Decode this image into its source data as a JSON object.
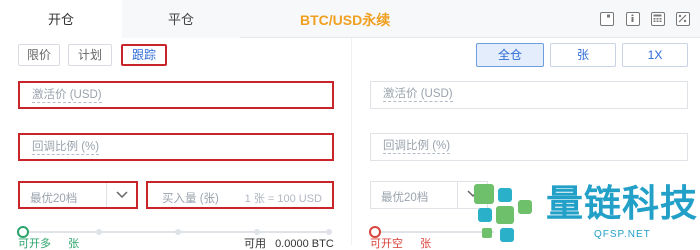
{
  "tabs": {
    "open": "开仓",
    "close": "平仓"
  },
  "market_title": "BTC/USD永续",
  "order_types": [
    {
      "label": "限价"
    },
    {
      "label": "计划"
    },
    {
      "label": "跟踪"
    }
  ],
  "amount_modes": [
    {
      "label": "全仓"
    },
    {
      "label": "张"
    },
    {
      "label": "1X"
    }
  ],
  "left_form": {
    "activation_placeholder": "激活价 (USD)",
    "callback_placeholder": "回调比例 (%)",
    "price_select": "最优20档",
    "buy_qty_placeholder": "买入量 (张)",
    "contract_hint": "1 张 = 100 USD",
    "open_label": "可开多",
    "open_value": "张",
    "available_label": "可用",
    "available_value": "0.0000 BTC"
  },
  "right_form": {
    "activation_placeholder": "激活价 (USD)",
    "callback_placeholder": "回调比例 (%)",
    "price_select": "最优20档",
    "open_label": "可开空",
    "open_value": "张"
  },
  "watermark": {
    "cn": "量链科技",
    "url": "QFSP.NET"
  },
  "colors": {
    "accent_blue": "#2d6bd6",
    "title_orange": "#f0a020",
    "highlight_red": "#c8252b",
    "long_green": "#2aa36b",
    "short_red": "#d9423a",
    "watermark_teal": "#22a0c8"
  }
}
